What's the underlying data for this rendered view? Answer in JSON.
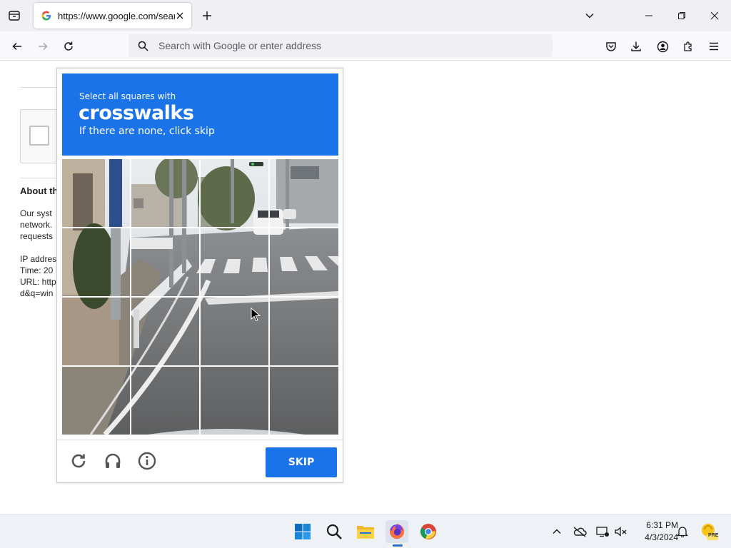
{
  "browser": {
    "tab_title": "https://www.google.com/search?q=",
    "url_placeholder": "Search with Google or enter address"
  },
  "background_page": {
    "heading": "About th",
    "para_lines": [
      "Our syst",
      "network.",
      "requests"
    ],
    "info_lines": [
      "IP addres",
      "Time: 20",
      "URL: http",
      "d&q=win"
    ]
  },
  "captcha": {
    "instruction": "Select all squares with",
    "target": "crosswalks",
    "hint": "If there are none, click skip",
    "grid_rows": 4,
    "grid_cols": 4,
    "reload_icon": "reload-icon",
    "audio_icon": "headphones-icon",
    "info_icon": "info-icon",
    "skip_label": "SKIP",
    "accent_color": "#1a73e8"
  },
  "taskbar": {
    "apps": [
      "windows-start-icon",
      "search-icon",
      "file-explorer-icon",
      "firefox-icon",
      "chrome-icon"
    ],
    "time": "6:31 PM",
    "date": "4/3/2024",
    "copilot_badge": "PRE"
  }
}
